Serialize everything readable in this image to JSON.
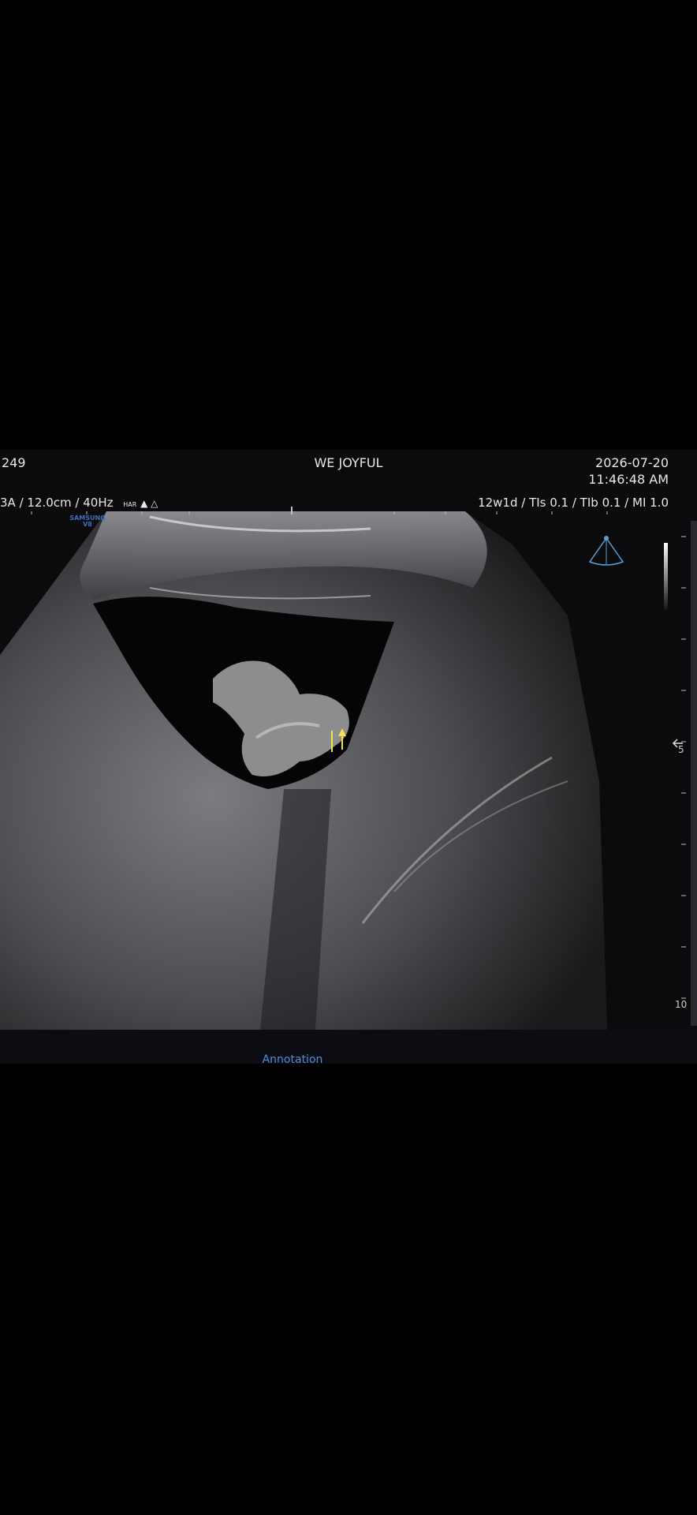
{
  "header": {
    "left_id": "249",
    "center_title": "WE JOYFUL",
    "date": "2026-07-20",
    "time": "11:46:48 AM"
  },
  "params": {
    "left": "3A / 12.0cm / 40Hz",
    "har_label": "HAR",
    "right": "12w1d / TIs  0.1 / TIb  0.1 / MI   1.0"
  },
  "brand": {
    "line1": "SAMSUNG",
    "line2": "V8"
  },
  "depth_scale": {
    "mid_label": "5",
    "bottom_label": "10"
  },
  "footer": {
    "annotation_label": "Annotation"
  },
  "icons": {
    "probe": "probe-orientation-icon",
    "arrow": "yellow-up-arrow-icon",
    "grayscale": "grayscale-bar-icon"
  },
  "colors": {
    "background": "#000000",
    "annotation_text": "#4f8fd6",
    "marker": "#f2e34a",
    "brand": "#3f6fbe"
  }
}
